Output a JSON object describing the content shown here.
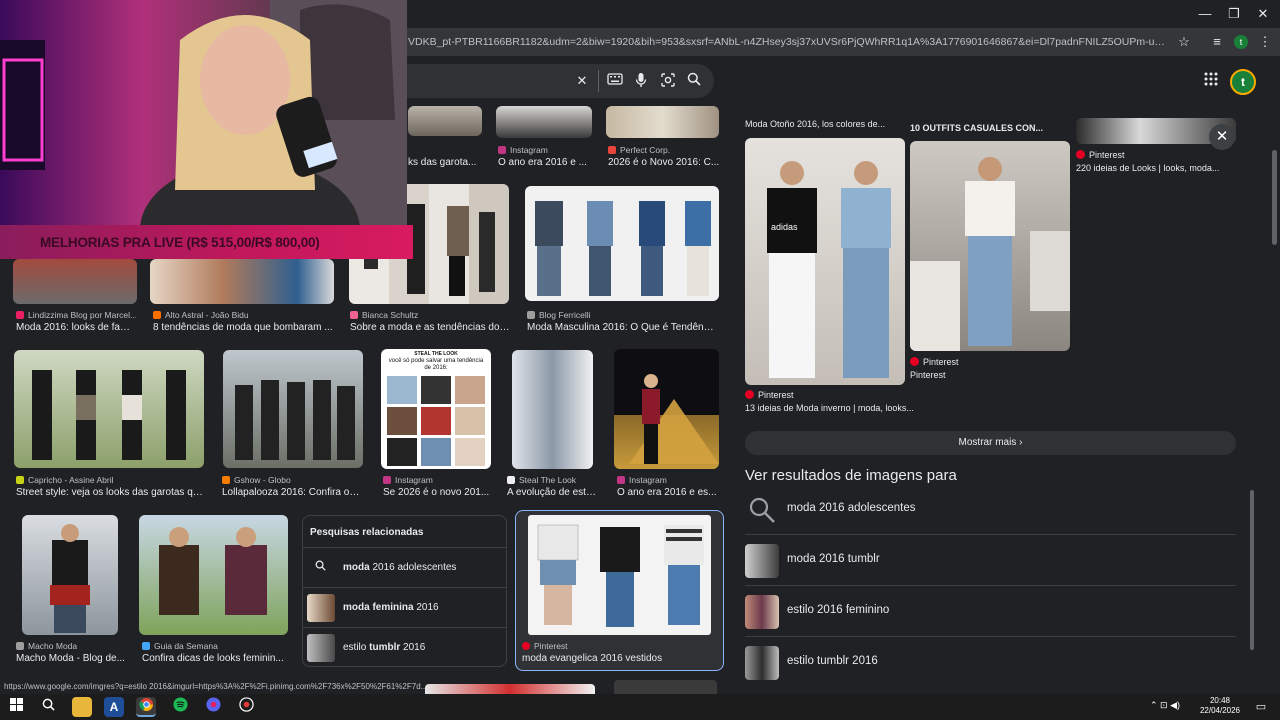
{
  "window": {
    "minimize": "—",
    "restore": "❐",
    "close": "✕"
  },
  "browser": {
    "url": "VDKB_pt-PTBR1166BR1182&udm=2&biw=1920&bih=953&sxsrf=ANbL-n4ZHsey3sj37xUVSr6PjQWhRR1q1A%3A1776901646867&ei=Dl7padnFNILZ5OUPm-u-qA4&oq=estilo+201&g...",
    "profile_letter": "t"
  },
  "search": {
    "clear_icon": "✕"
  },
  "account": {
    "letter": "t"
  },
  "webcam": {
    "banner": "MELHORIAS PRA LIVE (R$ 515,00/R$ 800,00)"
  },
  "results": {
    "row0": [
      {
        "source": "",
        "caption": ""
      },
      {
        "source": "",
        "caption": "ks das garota..."
      },
      {
        "source": "Instagram",
        "caption": "O ano era 2016 e ..."
      },
      {
        "source": "Perfect Corp.",
        "caption": "2026 é o Novo 2016: C..."
      }
    ],
    "row1": [
      {
        "source": "Lindizzima Blog por Marcel...",
        "caption": "Moda 2016: looks de fam..."
      },
      {
        "source": "Alto Astral - João Bidu",
        "caption": "8 tendências de moda que bombaram ..."
      },
      {
        "source": "Bianca Schultz",
        "caption": "Sobre a moda e as tendências do i..."
      },
      {
        "source": "Blog Ferricelli",
        "caption": "Moda Masculina 2016: O Que é Tendênci..."
      }
    ],
    "row2": [
      {
        "source": "Capricho - Assine Abril",
        "caption": "Street style: veja os looks das garotas qu..."
      },
      {
        "source": "Gshow - Globo",
        "caption": "Lollapalooza 2016: Confira os l..."
      },
      {
        "source": "Instagram",
        "caption": "Se 2026 é o novo 201..."
      },
      {
        "source": "Steal The Look",
        "caption": "A evolução de estil..."
      },
      {
        "source": "Instagram",
        "caption": "O ano era 2016 e es..."
      }
    ],
    "row3": [
      {
        "source": "Macho Moda",
        "caption": "Macho Moda - Blog de..."
      },
      {
        "source": "Guia da Semana",
        "caption": "Confira dicas de looks feminin..."
      },
      {
        "source": "Pinterest",
        "caption": "moda evangelica 2016 vestidos"
      }
    ],
    "steal_look_text": "STEAL THE LOOK",
    "steal_look_sub": "você só pode salvar uma tendência de 2016:"
  },
  "related": {
    "title": "Pesquisas relacionadas",
    "items": [
      {
        "bold": "moda",
        "rest": " 2016 adolescentes",
        "bold_first": true
      },
      {
        "bold": "moda feminina",
        "rest": " 2016",
        "bold_first": true
      },
      {
        "bold": "tumblr",
        "pre": "estilo ",
        "rest": " 2016",
        "bold_first": false
      }
    ]
  },
  "panel": {
    "top_caption_1": "Moda Otoño 2016, los colores de...",
    "top_caption_2": "10 OUTFITS CASUALES CON...",
    "pin_right_source": "Pinterest",
    "pin_right_caption": "220 ideias de Looks | looks, moda...",
    "pin_mid_source": "Pinterest",
    "pin_mid_caption": "Pinterest",
    "pin_left_source": "Pinterest",
    "pin_left_caption": "13 ideias de Moda inverno | moda, looks...",
    "more_label": "Mostrar mais",
    "section_title": "Ver resultados de imagens para",
    "suggestions": [
      "moda 2016 adolescentes",
      "moda 2016 tumblr",
      "estilo 2016 feminino",
      "estilo tumblr 2016"
    ],
    "adidas_text": "adidas"
  },
  "status_url": "https://www.google.com/imgres?q=estilo 2016&imgurl=https%3A%2F%2Fi.pinimg.com%2F736x%2F50%2F61%2F7d...",
  "taskbar": {
    "time": "20:48",
    "date": "22/04/2026",
    "tray": "⌃ ⊡ ◀)"
  }
}
